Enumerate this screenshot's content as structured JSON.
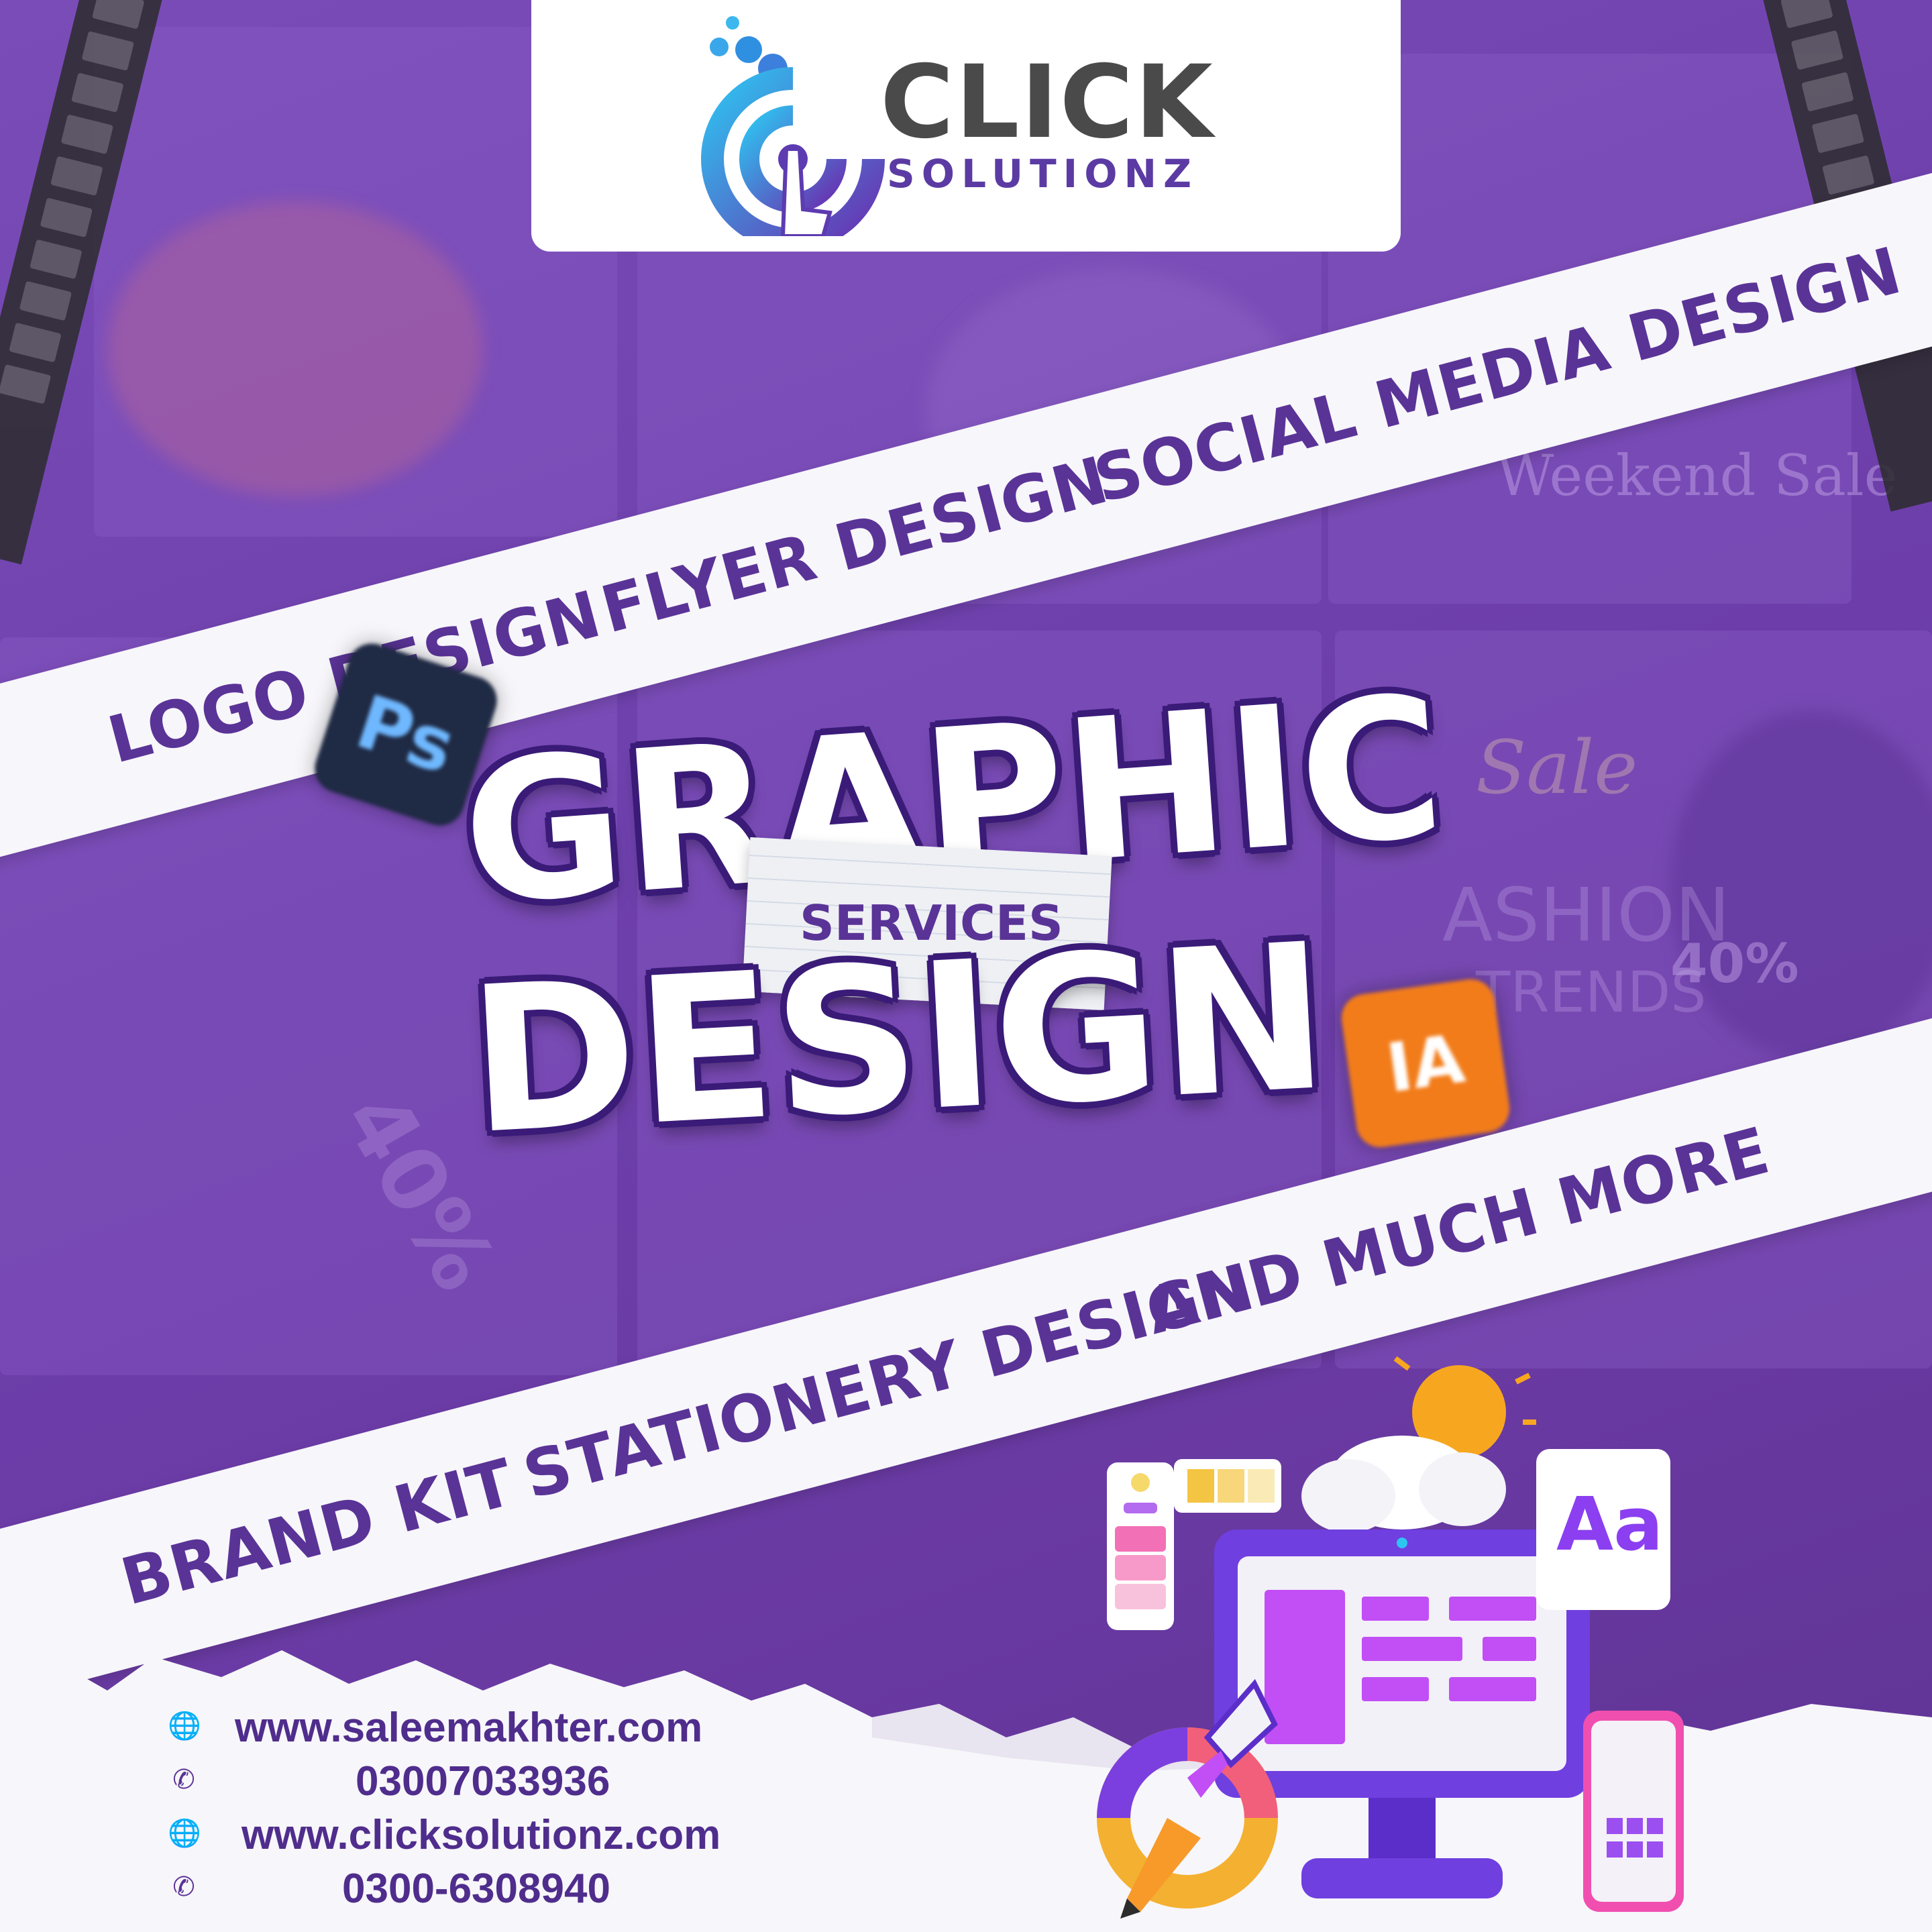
{
  "brand": {
    "name": "CLICK",
    "subname": "SOLUTIONZ"
  },
  "ribbon_top": {
    "items": [
      "LOGO DESIGN",
      "FLYER DESIGN",
      "SOCIAL MEDIA DESIGN"
    ]
  },
  "headline": {
    "line1": "GRAPHIC",
    "line2": "DESIGN",
    "tag": "SERVICES"
  },
  "ribbon_bottom": {
    "items": [
      "BRAND KIT",
      "STATIONERY DESIGN",
      "AND MUCH MORE"
    ]
  },
  "background_text": {
    "weekend_sale": "Weekend Sale",
    "fashion": "ASHION",
    "trends": "TRENDS",
    "discount_right": "40%",
    "discount_left": "40%",
    "sale": "Sale"
  },
  "icons": {
    "photoshop": "Ps",
    "illustrator": "IA",
    "font": "Aa"
  },
  "contact": {
    "website1": "www.saleemakhter.com",
    "phone1": "03007033936",
    "website2": "www.clicksolutionz.com",
    "phone2": "0300-6308940"
  },
  "colors": {
    "background": "#6a3fa6",
    "ribbon": "#f7f6fa",
    "ribbon_text": "#5a3397",
    "title_outline": "#3a1b78"
  }
}
